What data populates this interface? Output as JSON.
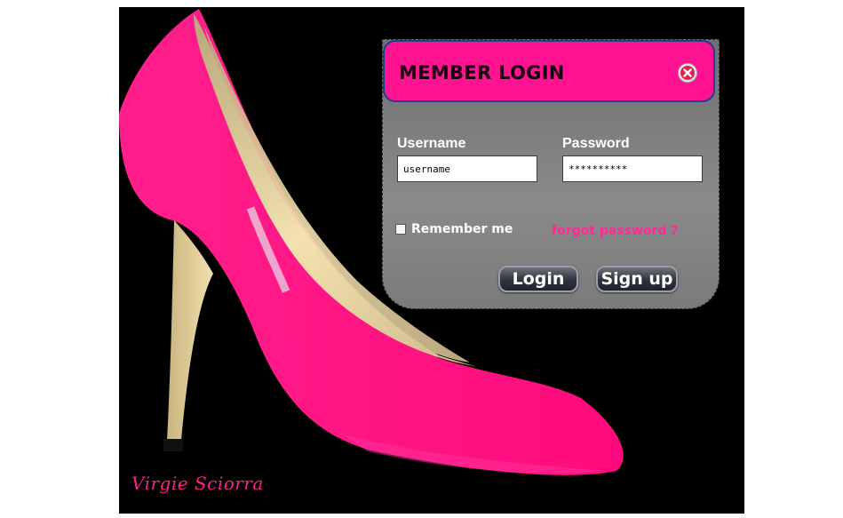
{
  "panel": {
    "title": "MEMBER LOGIN",
    "close_icon": "close-icon",
    "username_label": "Username",
    "username_value": "username",
    "password_label": "Password",
    "password_value": "**********",
    "remember_label": "Remember me",
    "remember_checked": false,
    "forgot_label": "forgot password ?",
    "login_label": "Login",
    "signup_label": "Sign up"
  },
  "brand": {
    "signature": "Virgie Sciorra"
  },
  "colors": {
    "accent_pink": "#ff1390",
    "header_border": "#1f3f8f",
    "background": "#000000"
  }
}
